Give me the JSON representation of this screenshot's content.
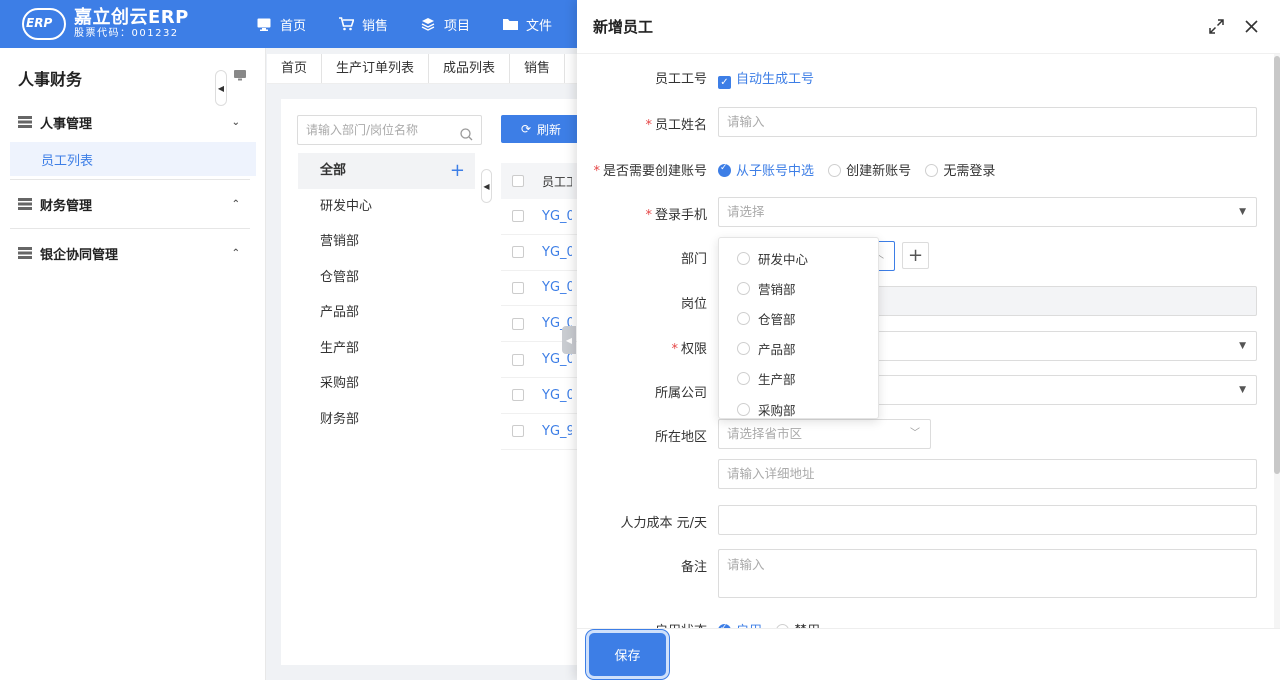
{
  "brand": {
    "name": "嘉立创云ERP",
    "stock_code": "股票代码：001232",
    "badge": "ERP"
  },
  "nav": [
    {
      "label": "首页",
      "icon": "monitor-icon"
    },
    {
      "label": "销售",
      "icon": "cart-icon"
    },
    {
      "label": "项目",
      "icon": "layers-icon"
    },
    {
      "label": "文件",
      "icon": "folder-icon"
    }
  ],
  "sidebar": {
    "title": "人事财务",
    "groups": [
      {
        "label": "人事管理",
        "chevron": "⌄",
        "sub": "员工列表"
      },
      {
        "label": "财务管理",
        "chevron": "⌃"
      },
      {
        "label": "银企协同管理",
        "chevron": "⌃"
      }
    ]
  },
  "tabs": [
    "首页",
    "生产订单列表",
    "成品列表",
    "销售"
  ],
  "main": {
    "search_placeholder": "请输入部门/岗位名称",
    "refresh_label": "刷新",
    "departments": [
      "全部",
      "研发中心",
      "营销部",
      "仓管部",
      "产品部",
      "生产部",
      "采购部",
      "财务部"
    ],
    "table_header": "员工工",
    "rows": [
      "YG_0",
      "YG_0",
      "YG_0",
      "YG_0",
      "YG_0",
      "YG_0",
      "YG_9"
    ]
  },
  "drawer": {
    "title": "新增员工",
    "fields": {
      "emp_no": {
        "label": "员工工号",
        "option": "自动生成工号"
      },
      "name": {
        "label": "员工姓名",
        "placeholder": "请输入"
      },
      "account": {
        "label": "是否需要创建账号",
        "options": [
          "从子账号中选",
          "创建新账号",
          "无需登录"
        ]
      },
      "phone": {
        "label": "登录手机",
        "placeholder": "请选择"
      },
      "dept": {
        "label": "部门"
      },
      "position": {
        "label": "岗位"
      },
      "permission": {
        "label": "权限"
      },
      "company": {
        "label": "所属公司"
      },
      "region": {
        "label": "所在地区",
        "placeholder": "请选择省市区"
      },
      "address": {
        "placeholder": "请输入详细地址"
      },
      "labor_cost": {
        "label": "人力成本 元/天"
      },
      "remark": {
        "label": "备注",
        "placeholder": "请输入"
      },
      "status": {
        "label": "启用状态",
        "options": [
          "启用",
          "禁用"
        ]
      }
    },
    "dept_options": [
      "研发中心",
      "营销部",
      "仓管部",
      "产品部",
      "生产部",
      "采购部"
    ],
    "save_label": "保存"
  },
  "colors": {
    "primary": "#3d7ee6",
    "required": "#e54545"
  }
}
